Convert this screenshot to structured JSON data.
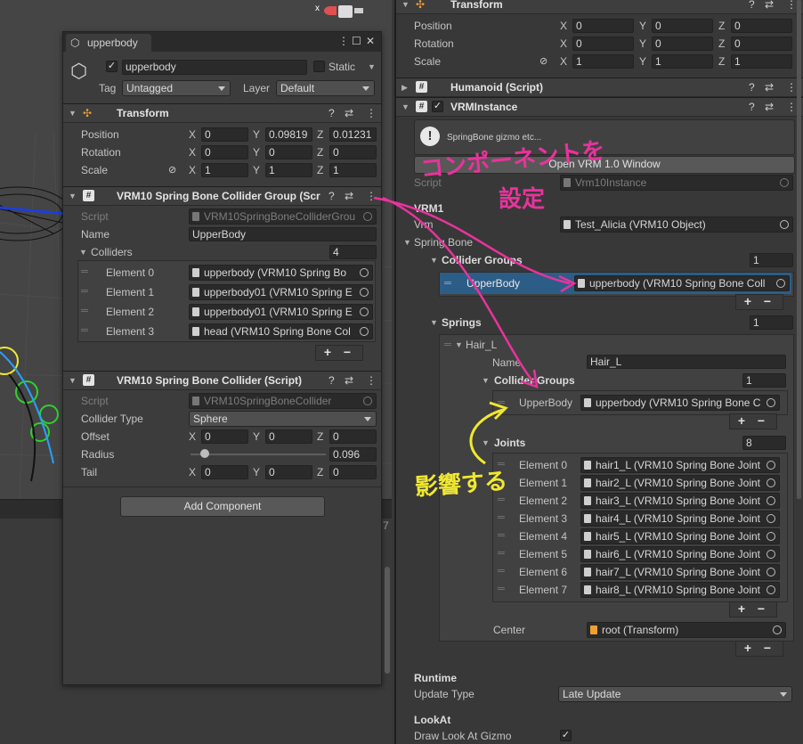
{
  "colors": {
    "selection": "#2c5d87",
    "annotation_red": "#e8339c",
    "annotation_yellow": "#f0e830",
    "background": "#383838"
  },
  "left": {
    "window_title": "upperbody",
    "object_name": "upperbody",
    "static_label": "Static",
    "tag_label": "Tag",
    "tag_value": "Untagged",
    "layer_label": "Layer",
    "layer_value": "Default",
    "transform": {
      "title": "Transform",
      "position_label": "Position",
      "rotation_label": "Rotation",
      "scale_label": "Scale",
      "position": [
        "0",
        "0.09819",
        "0.01231"
      ],
      "rotation": [
        "0",
        "0",
        "0"
      ],
      "scale": [
        "1",
        "1",
        "1"
      ]
    },
    "group": {
      "title": "VRM10 Spring Bone Collider Group (Scr",
      "script_label": "Script",
      "script_value": "VRM10SpringBoneColliderGrou",
      "name_label": "Name",
      "name_value": "UpperBody",
      "colliders_label": "Colliders",
      "colliders_count": "4",
      "elements": [
        {
          "label": "Element 0",
          "value": "upperbody (VRM10 Spring Bo"
        },
        {
          "label": "Element 1",
          "value": "upperbody01 (VRM10 Spring E"
        },
        {
          "label": "Element 2",
          "value": "upperbody01 (VRM10 Spring E"
        },
        {
          "label": "Element 3",
          "value": "head (VRM10 Spring Bone Col"
        }
      ]
    },
    "collider": {
      "title": "VRM10 Spring Bone Collider (Script)",
      "script_label": "Script",
      "script_value": "VRM10SpringBoneCollider",
      "type_label": "Collider Type",
      "type_value": "Sphere",
      "offset_label": "Offset",
      "offset": [
        "0",
        "0",
        "0"
      ],
      "radius_label": "Radius",
      "radius_value": "0.096",
      "tail_label": "Tail",
      "tail": [
        "0",
        "0",
        "0"
      ]
    },
    "add_component": "Add Component"
  },
  "right": {
    "transform": {
      "title": "Transform",
      "position_label": "Position",
      "rotation_label": "Rotation",
      "scale_label": "Scale",
      "position": [
        "0",
        "0",
        "0"
      ],
      "rotation": [
        "0",
        "0",
        "0"
      ],
      "scale": [
        "1",
        "1",
        "1"
      ]
    },
    "humanoid_title": "Humanoid (Script)",
    "vrminstance_title": "VRMInstance",
    "info_text": "SpringBone gizmo etc...",
    "open_window_button": "Open VRM 1.0 Window",
    "script_label": "Script",
    "script_value": "Vrm10Instance",
    "vrm_section": "VRM1",
    "vrm_label": "Vrm",
    "vrm_value": "Test_Alicia (VRM10 Object)",
    "spring_bone_label": "Spring Bone",
    "collider_groups_label": "Collider Groups",
    "collider_groups_count": "1",
    "collider_group_row": {
      "label": "UpperBody",
      "value": "upperbody (VRM10 Spring Bone Coll"
    },
    "springs_label": "Springs",
    "springs_count": "1",
    "hair_label": "Hair_L",
    "name_label": "Name",
    "name_value": "Hair_L",
    "spring_collider_groups_label": "Collider Groups",
    "spring_collider_groups_count": "1",
    "spring_collider_row": {
      "label": "UpperBody",
      "value": "upperbody (VRM10 Spring Bone C"
    },
    "joints_label": "Joints",
    "joints_count": "8",
    "joints": [
      {
        "label": "Element 0",
        "value": "hair1_L (VRM10 Spring Bone Joint"
      },
      {
        "label": "Element 1",
        "value": "hair2_L (VRM10 Spring Bone Joint"
      },
      {
        "label": "Element 2",
        "value": "hair3_L (VRM10 Spring Bone Joint"
      },
      {
        "label": "Element 3",
        "value": "hair4_L (VRM10 Spring Bone Joint"
      },
      {
        "label": "Element 4",
        "value": "hair5_L (VRM10 Spring Bone Joint"
      },
      {
        "label": "Element 5",
        "value": "hair6_L (VRM10 Spring Bone Joint"
      },
      {
        "label": "Element 6",
        "value": "hair7_L (VRM10 Spring Bone Joint"
      },
      {
        "label": "Element 7",
        "value": "hair8_L (VRM10 Spring Bone Joint"
      }
    ],
    "center_label": "Center",
    "center_value": "root (Transform)",
    "runtime_label": "Runtime",
    "update_type_label": "Update Type",
    "update_type_value": "Late Update",
    "lookat_label": "LookAt",
    "draw_lookat_label": "Draw Look At Gizmo"
  },
  "annotations": {
    "red_text_line1": "コンポーネントを",
    "red_text_line2": "設定",
    "yellow_text": "影響する"
  }
}
